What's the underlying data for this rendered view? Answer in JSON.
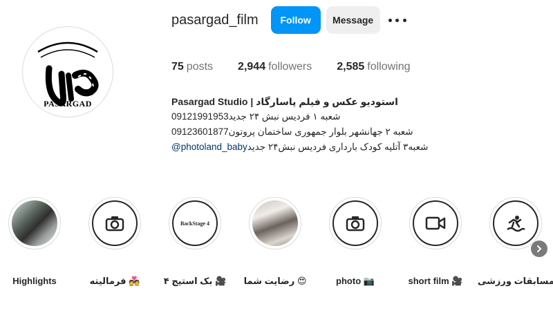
{
  "profile": {
    "username": "pasargad_film",
    "follow_label": "Follow",
    "message_label": "Message",
    "more_icon": "more-dots-icon",
    "avatar_brand": "PASARGAD",
    "avatar_script": "ﺲ ﺶ ﺷ ﺸ ﺹ ﺺ ﺻ"
  },
  "stats": {
    "posts_count": "75",
    "posts_label": "posts",
    "followers_count": "2,944",
    "followers_label": "followers",
    "following_count": "2,585",
    "following_label": "following"
  },
  "bio": {
    "name": "Pasargad Studio | استودیو عکس و فیلم پاسارگاد",
    "line1": "شعبه ۱ فردیس نبش ۲۴ جدید09121991953",
    "line2": "شعبه ۲ جهانشهر بلوار جمهوری ساختمان پروتون09123601877",
    "line3_text": "شعبه۳ آتلیه کودک بارداری فردیس نبش۲۴ جدید ",
    "line3_link": "@photoland_baby"
  },
  "highlights": [
    {
      "label": "Highlights",
      "icon": "photo-thumbnail"
    },
    {
      "label": "فرمالیته 💑",
      "icon": "camera-icon"
    },
    {
      "label": "بک استیج ۴ 🎥",
      "icon": "backstage-text",
      "inner_text": "BackStage 4"
    },
    {
      "label": "رضایت شما 😍",
      "icon": "photo-thumbnail"
    },
    {
      "label": "photo 📷",
      "icon": "camera-icon"
    },
    {
      "label": "short film 🎥",
      "icon": "video-camera-icon"
    },
    {
      "label": "مسابقات ورزشی",
      "icon": "sports-icon"
    }
  ],
  "colors": {
    "accent": "#0095f6",
    "text": "#262626",
    "muted": "#737373",
    "link": "#00376b"
  }
}
